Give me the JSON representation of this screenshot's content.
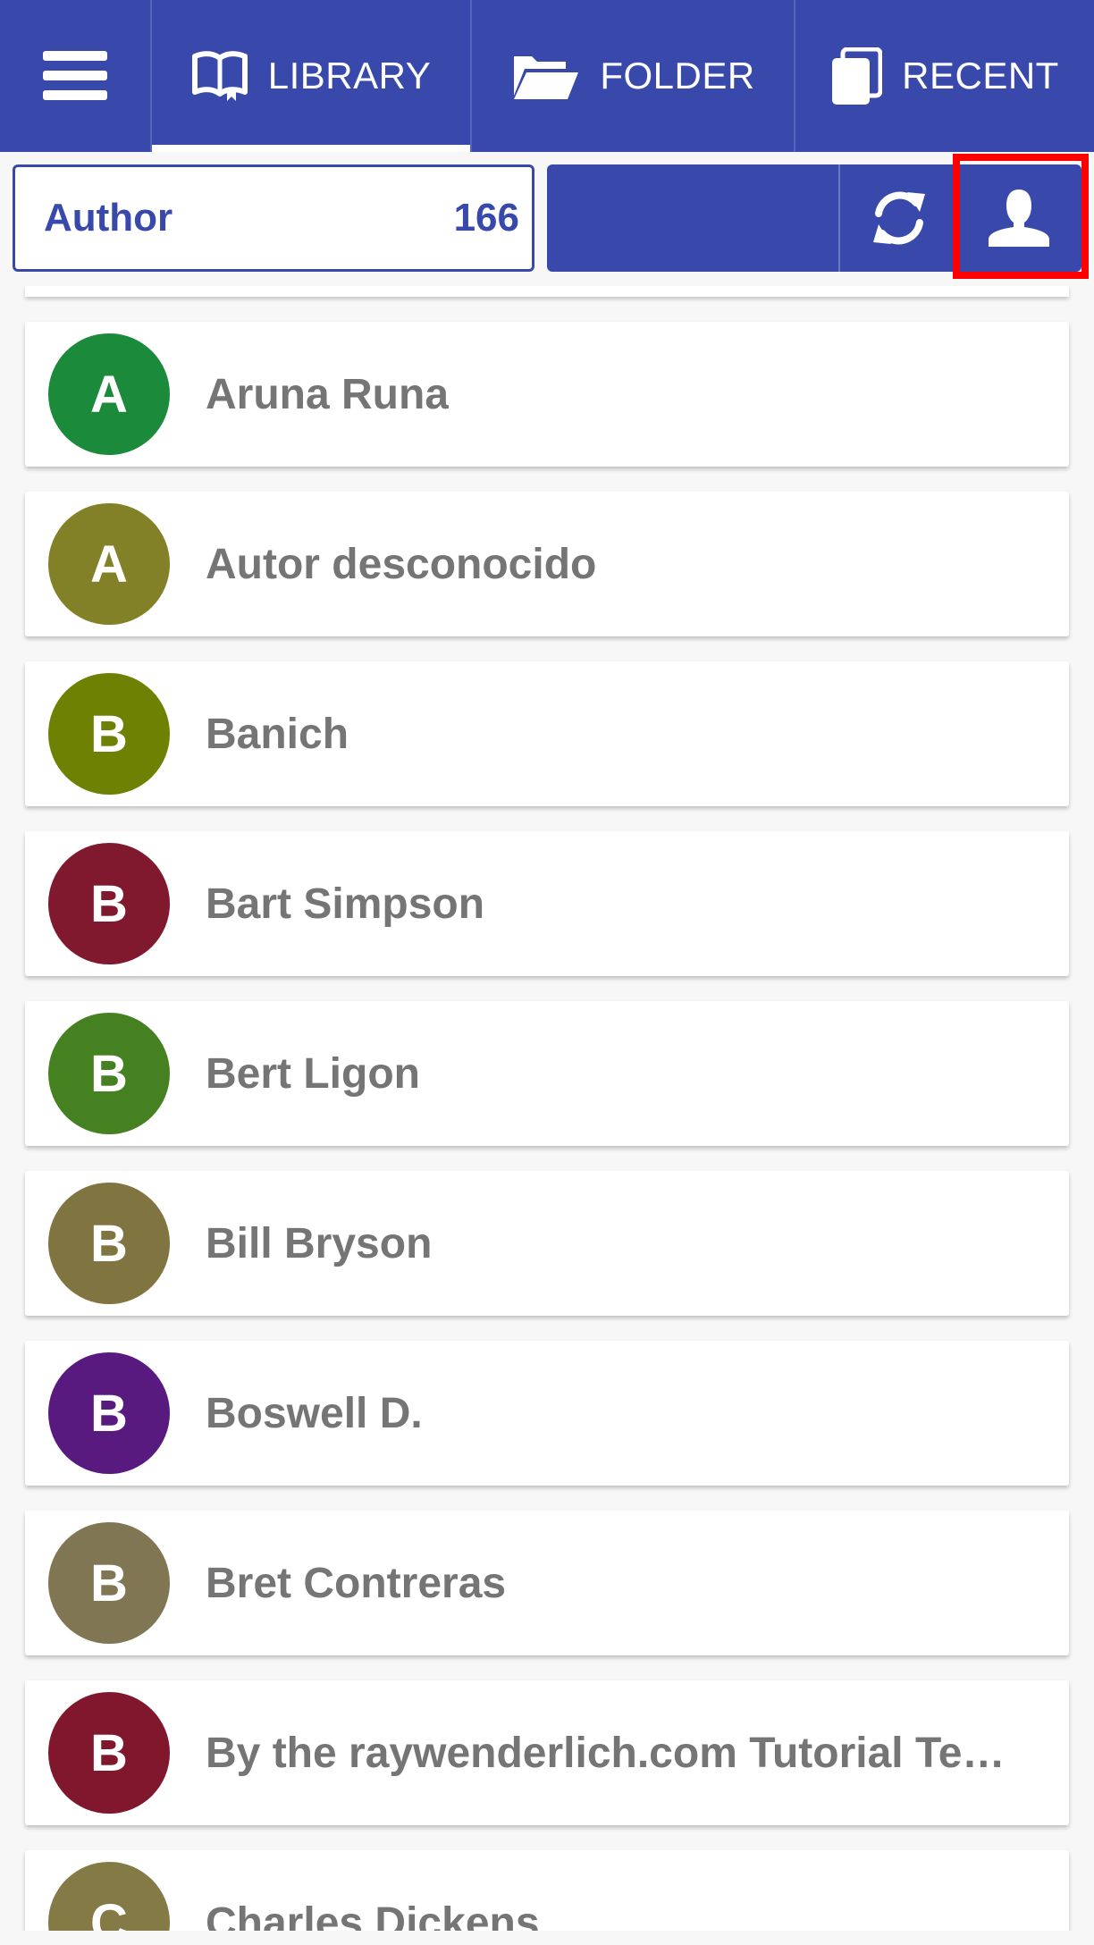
{
  "tabs": [
    {
      "label": "LIBRARY",
      "icon": "book-open-icon",
      "active": true
    },
    {
      "label": "FOLDER",
      "icon": "folder-open-icon",
      "active": false
    },
    {
      "label": "RECENT",
      "icon": "book-stack-icon",
      "active": false
    }
  ],
  "filter": {
    "label": "Author",
    "count": "166"
  },
  "colors": {
    "primary": "#3949ab",
    "highlight": "#ff0000"
  },
  "authors": [
    {
      "initial": "A",
      "name": "Aruna Runa",
      "color": "#1b8a3a"
    },
    {
      "initial": "A",
      "name": "Autor desconocido",
      "color": "#838127"
    },
    {
      "initial": "B",
      "name": "Banich",
      "color": "#6e8103"
    },
    {
      "initial": "B",
      "name": "Bart Simpson",
      "color": "#80192d"
    },
    {
      "initial": "B",
      "name": "Bert Ligon",
      "color": "#458120"
    },
    {
      "initial": "B",
      "name": "Bill Bryson",
      "color": "#807541"
    },
    {
      "initial": "B",
      "name": "Boswell D.",
      "color": "#591a80"
    },
    {
      "initial": "B",
      "name": "Bret Contreras",
      "color": "#807654"
    },
    {
      "initial": "B",
      "name": "By the raywenderlich.com Tutorial Te…",
      "color": "#80172d"
    },
    {
      "initial": "C",
      "name": "Charles Dickens",
      "color": "#837a45"
    }
  ]
}
